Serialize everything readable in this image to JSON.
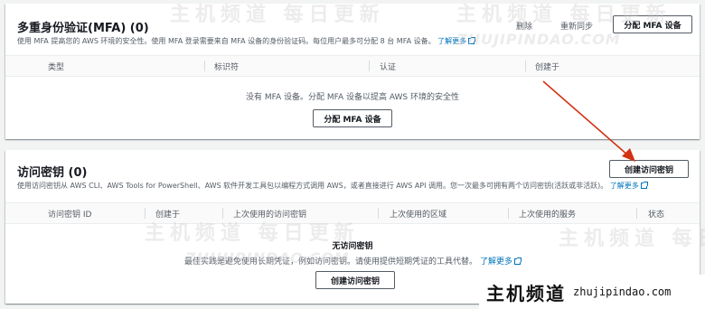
{
  "mfa": {
    "title": "多重身份验证(MFA) (0)",
    "desc": "使用 MFA 提高您的 AWS 环境的安全性。使用 MFA 登录需要来自 MFA 设备的身份验证码。每位用户最多可分配 8 台 MFA 设备。",
    "learn_more": "了解更多",
    "buttons": {
      "delete": "删除",
      "resync": "重新同步",
      "assign": "分配 MFA 设备"
    },
    "columns": [
      "类型",
      "标识符",
      "认证",
      "创建于"
    ],
    "empty_text": "没有 MFA 设备。分配 MFA 设备以提高 AWS 环境的安全性",
    "empty_button": "分配 MFA 设备"
  },
  "access_keys": {
    "title": "访问密钥 (0)",
    "desc": "使用访问密钥从 AWS CLI、AWS Tools for PowerShell、AWS 软件开发工具包以编程方式调用 AWS，或者直接进行 AWS API 调用。您一次最多可拥有两个访问密钥(活跃或非活跃)。",
    "learn_more": "了解更多",
    "create_button": "创建访问密钥",
    "columns": [
      "访问密钥 ID",
      "创建于",
      "上次使用的访问密钥",
      "上次使用的区域",
      "上次使用的服务",
      "状态"
    ],
    "empty_title": "无访问密钥",
    "empty_text": "最佳实践是避免使用长期凭证，例如访问密钥。请使用提供短期凭证的工具代替。",
    "empty_learn_more": "了解更多",
    "empty_button": "创建访问密钥"
  },
  "watermark": {
    "cn": "主机频道 每日更新",
    "en": "ZHUJIPINDAO.COM"
  },
  "brand": {
    "cn": "主机频道",
    "url": "zhujipindao.com"
  },
  "colors": {
    "link": "#0073bb",
    "arrow": "#d13212",
    "text": "#16191f",
    "muted": "#545b64"
  }
}
